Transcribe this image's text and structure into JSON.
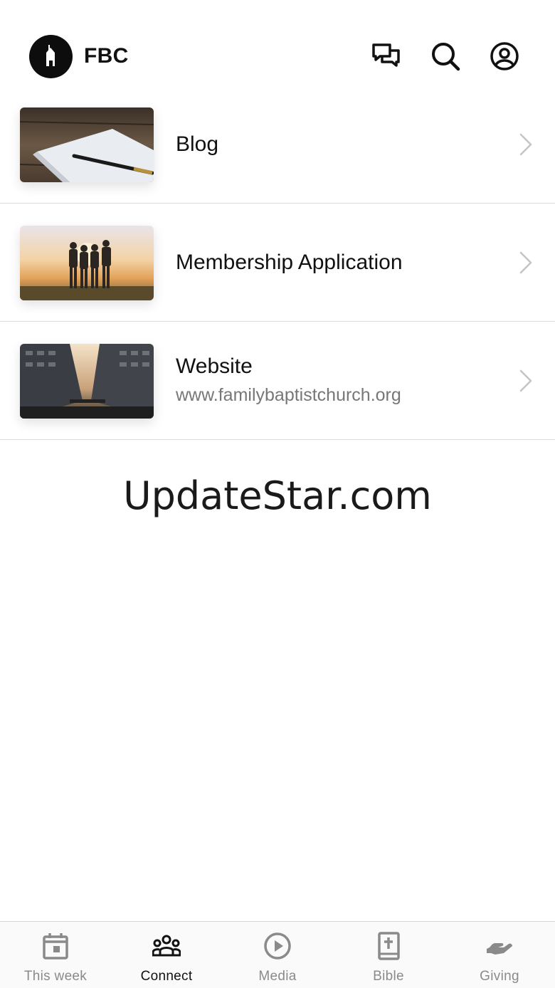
{
  "header": {
    "title": "FBC",
    "icons": [
      "chat-icon",
      "search-icon",
      "profile-icon"
    ]
  },
  "list": {
    "items": [
      {
        "title": "Blog",
        "subtitle": "",
        "thumbnail": "notebook-pen-photo"
      },
      {
        "title": "Membership Application",
        "subtitle": "",
        "thumbnail": "group-sunset-photo"
      },
      {
        "title": "Website",
        "subtitle": "www.familybaptistchurch.org",
        "thumbnail": "city-street-photo"
      }
    ]
  },
  "watermark": "UpdateStar.com",
  "tabbar": {
    "active": "Connect",
    "tabs": [
      {
        "label": "This week",
        "icon": "calendar-icon"
      },
      {
        "label": "Connect",
        "icon": "people-icon"
      },
      {
        "label": "Media",
        "icon": "play-icon"
      },
      {
        "label": "Bible",
        "icon": "bible-icon"
      },
      {
        "label": "Giving",
        "icon": "hand-icon"
      }
    ]
  },
  "colors": {
    "text": "#111111",
    "subtitle": "#777777",
    "inactive_tab": "#8a8a8a",
    "divider": "#dcdcdc"
  }
}
